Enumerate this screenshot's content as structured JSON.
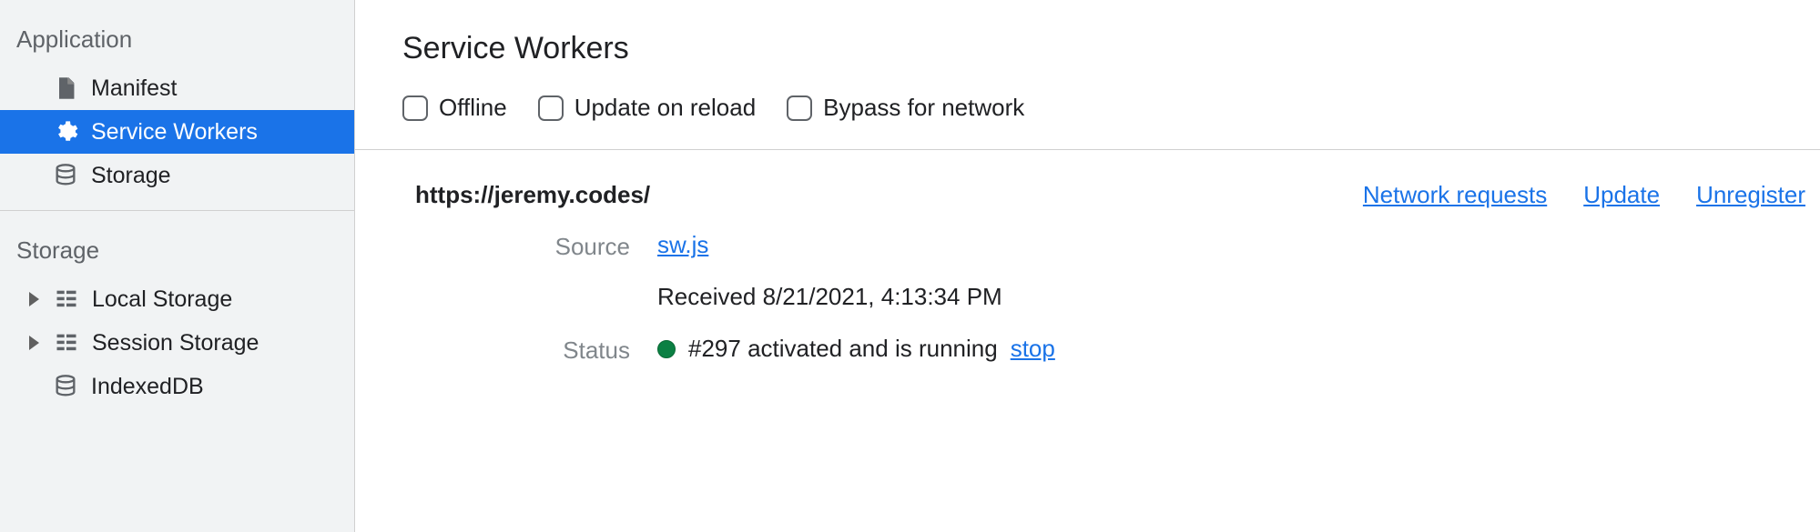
{
  "sidebar": {
    "sections": {
      "application": {
        "header": "Application",
        "items": [
          {
            "label": "Manifest"
          },
          {
            "label": "Service Workers"
          },
          {
            "label": "Storage"
          }
        ]
      },
      "storage": {
        "header": "Storage",
        "items": [
          {
            "label": "Local Storage"
          },
          {
            "label": "Session Storage"
          },
          {
            "label": "IndexedDB"
          }
        ]
      }
    }
  },
  "main": {
    "title": "Service Workers",
    "toolbar": {
      "offline": "Offline",
      "update_on_reload": "Update on reload",
      "bypass": "Bypass for network"
    },
    "origin": "https://jeremy.codes/",
    "origin_links": {
      "network": "Network requests",
      "update": "Update",
      "unregister": "Unregister"
    },
    "details": {
      "source_label": "Source",
      "source_file": "sw.js",
      "received": "Received 8/21/2021, 4:13:34 PM",
      "status_label": "Status",
      "status_text": "#297 activated and is running",
      "stop": "stop"
    }
  }
}
